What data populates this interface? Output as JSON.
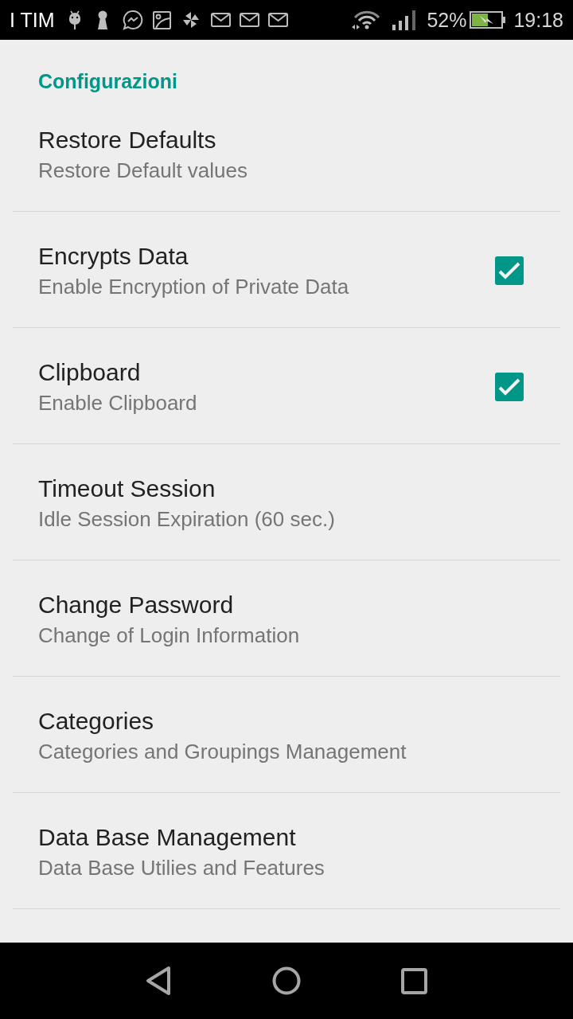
{
  "status_bar": {
    "carrier": "I TIM",
    "battery_percent": "52%",
    "time": "19:18"
  },
  "section": {
    "title": "Configurazioni"
  },
  "preferences": [
    {
      "kind": "plain",
      "title": "Restore Defaults",
      "summary": "Restore Default values"
    },
    {
      "kind": "checkbox",
      "title": "Encrypts Data",
      "summary": "Enable Encryption of Private Data",
      "checked": true
    },
    {
      "kind": "checkbox",
      "title": "Clipboard",
      "summary": "Enable Clipboard",
      "checked": true
    },
    {
      "kind": "plain",
      "title": "Timeout Session",
      "summary": "Idle Session Expiration (60 sec.)"
    },
    {
      "kind": "plain",
      "title": "Change Password",
      "summary": "Change of Login Information"
    },
    {
      "kind": "plain",
      "title": "Categories",
      "summary": "Categories and Groupings Management"
    },
    {
      "kind": "plain",
      "title": "Data Base Management",
      "summary": "Data Base Utilies and Features"
    }
  ]
}
